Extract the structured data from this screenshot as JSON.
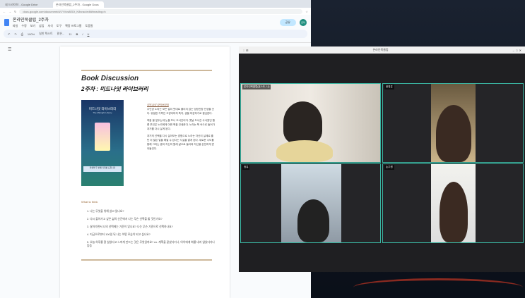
{
  "browser": {
    "tabs": [
      {
        "label": "내 드라이브 - Google Drive"
      },
      {
        "label": "온라인북클럽_2주차 - Google Docs"
      }
    ],
    "url": "docs.google.com/document/d/1YVcs8EDt_K8nrac/edit#heading=h"
  },
  "docs": {
    "title": "온라인북클럽_2주차",
    "menus": [
      "파일",
      "수정",
      "보기",
      "삽입",
      "서식",
      "도구",
      "확장 프로그램",
      "도움말"
    ],
    "share": "공유",
    "avatar": "온라",
    "toolbar": {
      "zoom": "100%",
      "style": "일반 텍스트",
      "font": "맑은...",
      "size": "11"
    }
  },
  "page": {
    "heading": "Book Discussion",
    "subheading": "2주차 : 미드나잇 라이브러리",
    "cover": {
      "title": "미드나잇 라이브러리",
      "subtitle": "The Midnight Library",
      "band": "인생의 두 번째 기회를 드립니다"
    },
    "desc_title": "미드나잇 라이브러리",
    "desc": [
      "주인공 노라는 모든 일이 뜻대로 풀리지 않는 엉망진창 인생을 산다. 유일한 가족인 고양이마저 죽자, 생을 마감하기로 결심한다.",
      "죽음 을 앞두는데 눈을 뜨니 도서관이다. 옛날 도서관 사서였던 엘름 부인은 노라에게 어떤 책을 건네준다. 노라는 책 속으로 들어가 과거를 다시 살게 된다.",
      "과거의 선택을 다시 살아보는 경험으로 노라는 자신이 실제로 훌틴 더 많은 일을 해낼 수 있다는 사실을 알게 된다. 새로운 시도를 통해 그리는 결국 자신의 원래 삶으로 돌아와 자신을 온전하게 받아들인다."
    ],
    "what_to_think": "What to think",
    "questions": [
      "1.  나는 무엇을 위해 살고 있나요?",
      "2.  다시 돌아가고 싶은 삶의 순간에서 나는 무슨 선택을 할 것인가요?",
      "3.  살아가면서 나의 선택에는 기준이 있나요? 나는 무슨 기준으로 선택하나요?",
      "4.  지금으로부터 100일 뒤 나는 어떤 모습이 되고 싶나요?",
      "5.  오늘 하루를 잘 살았다고 느끼게 만드는 것은 무엇일까요? ex. 계획을 끝냈다거나, 아이에게 화를 내지 않았다거나 등등"
    ]
  },
  "video": {
    "title": "온라인북클럽",
    "participants": [
      {
        "name": "온라인북클럽(호스트, 나)"
      },
      {
        "name": "윤영은"
      },
      {
        "name": "정유"
      },
      {
        "name": "손주원"
      }
    ]
  },
  "colors": {
    "accent": "#3ab3a0",
    "rule": "#cdb89a"
  }
}
